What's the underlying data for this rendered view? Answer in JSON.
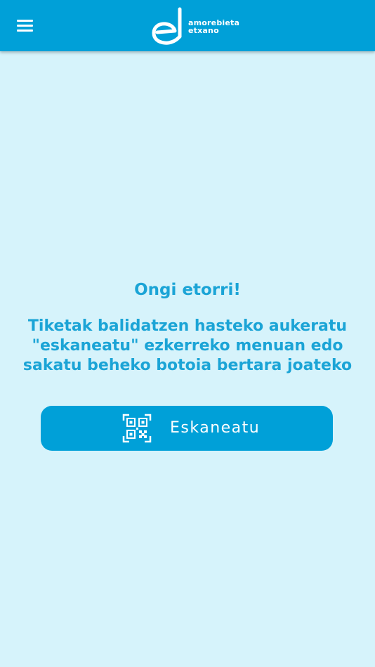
{
  "header": {
    "menu_icon": "hamburger-menu-icon",
    "logo": {
      "line1": "amorebieta",
      "line2": "etxano"
    },
    "background_color": "#00a0d8"
  },
  "main": {
    "welcome_title": "Ongi etorri!",
    "instructions": "Tiketak balidatzen hasteko aukeratu \"eskaneatu\" ezkerreko menuan edo sakatu beheko botoia bertara joateko",
    "scan_button": {
      "label": "Eskaneatu",
      "icon": "qr-code-scan-icon"
    },
    "text_color": "#1ba4d6",
    "background_color": "#d6f3fb"
  }
}
